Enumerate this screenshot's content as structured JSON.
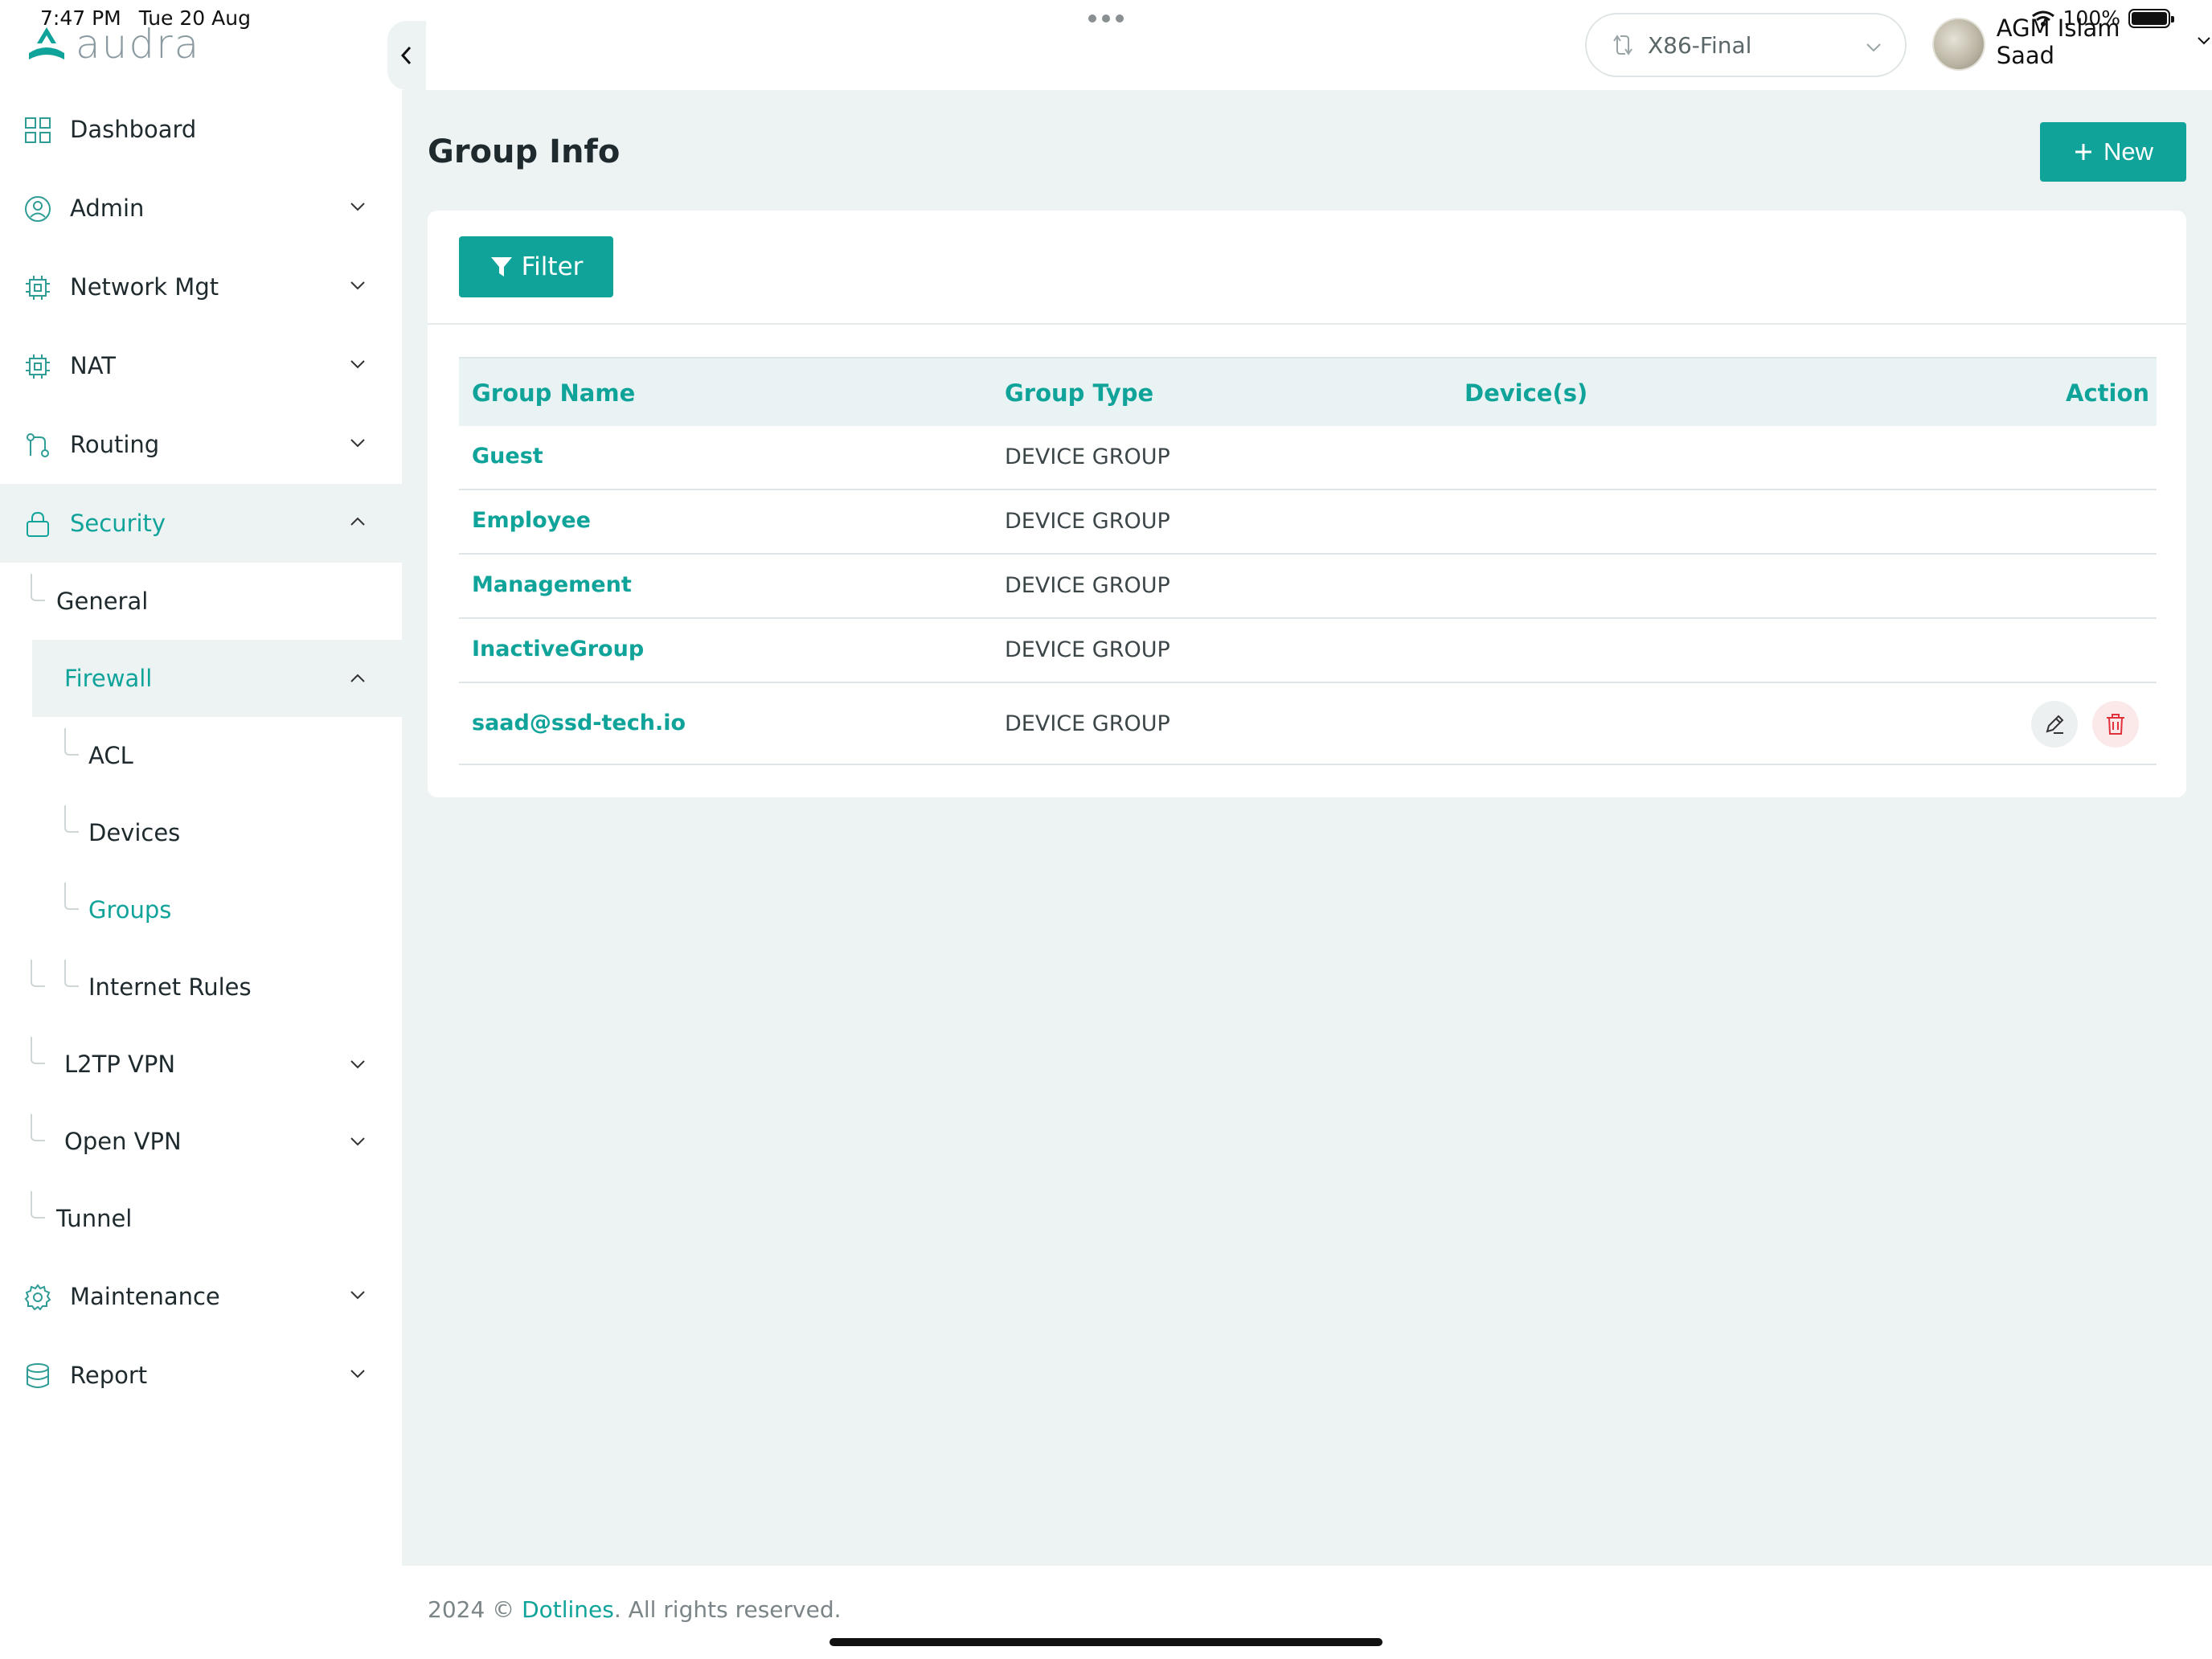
{
  "status_bar": {
    "time": "7:47 PM",
    "date": "Tue 20 Aug",
    "battery": "100%"
  },
  "brand": {
    "logo_text": "audra",
    "accent_color": "#0fa39a"
  },
  "header": {
    "device": "X86-Final",
    "user_name": "AGM Islam Saad"
  },
  "sidebar": {
    "items": [
      {
        "label": "Dashboard",
        "icon": "dashboard-icon"
      },
      {
        "label": "Admin",
        "icon": "user-circle-icon"
      },
      {
        "label": "Network Mgt",
        "icon": "chip-icon"
      },
      {
        "label": "NAT",
        "icon": "chip-icon"
      },
      {
        "label": "Routing",
        "icon": "git-branch-icon"
      },
      {
        "label": "Security",
        "icon": "lock-icon"
      },
      {
        "label": "Maintenance",
        "icon": "gear-icon"
      },
      {
        "label": "Report",
        "icon": "database-icon"
      }
    ],
    "security_sub": {
      "general": "General",
      "firewall": "Firewall",
      "acl": "ACL",
      "devices": "Devices",
      "groups": "Groups",
      "internet_rules": "Internet Rules",
      "l2tp_vpn": "L2TP VPN",
      "open_vpn": "Open VPN",
      "tunnel": "Tunnel"
    }
  },
  "page": {
    "title": "Group Info",
    "new_label": "New",
    "filter_label": "Filter"
  },
  "table": {
    "columns": [
      "Group Name",
      "Group Type",
      "Device(s)",
      "Action"
    ],
    "rows": [
      {
        "name": "Guest",
        "type": "DEVICE GROUP"
      },
      {
        "name": "Employee",
        "type": "DEVICE GROUP"
      },
      {
        "name": "Management",
        "type": "DEVICE GROUP"
      },
      {
        "name": "InactiveGroup",
        "type": "DEVICE GROUP"
      },
      {
        "name": "saad@ssd-tech.io",
        "type": "DEVICE GROUP"
      }
    ]
  },
  "footer": {
    "year_copy": "2024 ©",
    "company": "Dotlines",
    "rights": ". All rights reserved."
  }
}
